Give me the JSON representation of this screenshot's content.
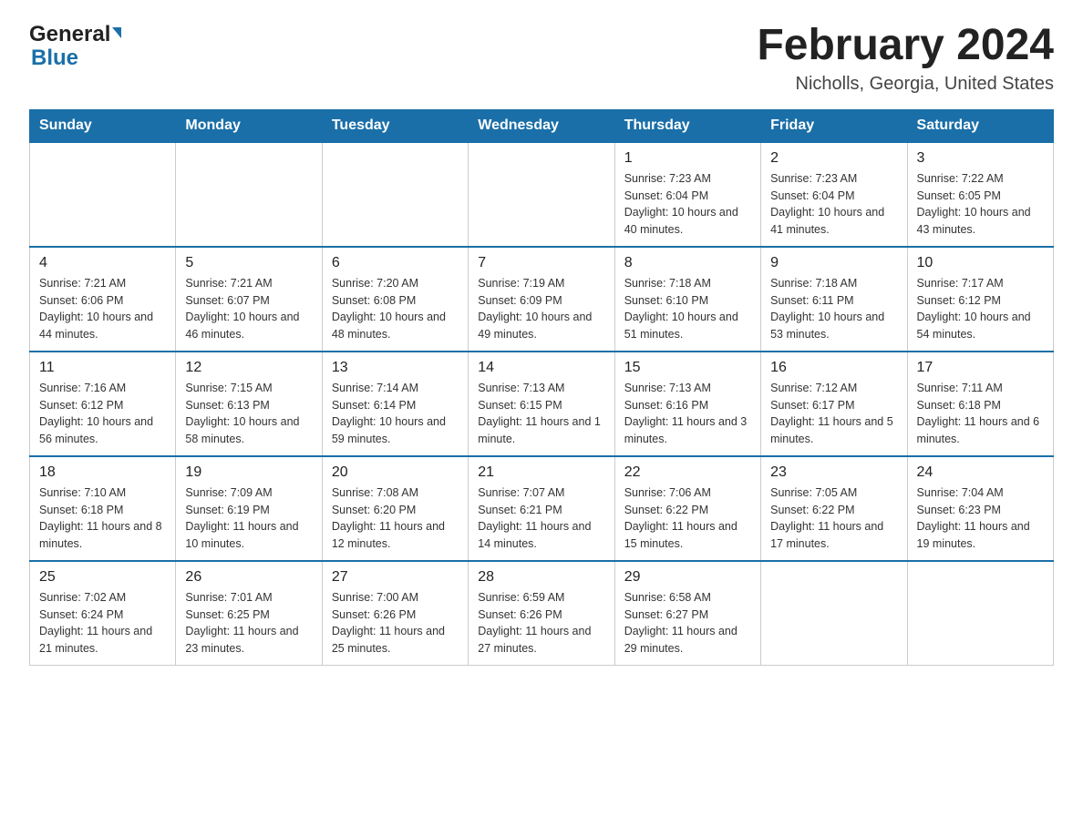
{
  "header": {
    "logo_general": "General",
    "logo_blue": "Blue",
    "title": "February 2024",
    "subtitle": "Nicholls, Georgia, United States"
  },
  "weekdays": [
    "Sunday",
    "Monday",
    "Tuesday",
    "Wednesday",
    "Thursday",
    "Friday",
    "Saturday"
  ],
  "weeks": [
    [
      {
        "day": "",
        "info": ""
      },
      {
        "day": "",
        "info": ""
      },
      {
        "day": "",
        "info": ""
      },
      {
        "day": "",
        "info": ""
      },
      {
        "day": "1",
        "info": "Sunrise: 7:23 AM\nSunset: 6:04 PM\nDaylight: 10 hours and 40 minutes."
      },
      {
        "day": "2",
        "info": "Sunrise: 7:23 AM\nSunset: 6:04 PM\nDaylight: 10 hours and 41 minutes."
      },
      {
        "day": "3",
        "info": "Sunrise: 7:22 AM\nSunset: 6:05 PM\nDaylight: 10 hours and 43 minutes."
      }
    ],
    [
      {
        "day": "4",
        "info": "Sunrise: 7:21 AM\nSunset: 6:06 PM\nDaylight: 10 hours and 44 minutes."
      },
      {
        "day": "5",
        "info": "Sunrise: 7:21 AM\nSunset: 6:07 PM\nDaylight: 10 hours and 46 minutes."
      },
      {
        "day": "6",
        "info": "Sunrise: 7:20 AM\nSunset: 6:08 PM\nDaylight: 10 hours and 48 minutes."
      },
      {
        "day": "7",
        "info": "Sunrise: 7:19 AM\nSunset: 6:09 PM\nDaylight: 10 hours and 49 minutes."
      },
      {
        "day": "8",
        "info": "Sunrise: 7:18 AM\nSunset: 6:10 PM\nDaylight: 10 hours and 51 minutes."
      },
      {
        "day": "9",
        "info": "Sunrise: 7:18 AM\nSunset: 6:11 PM\nDaylight: 10 hours and 53 minutes."
      },
      {
        "day": "10",
        "info": "Sunrise: 7:17 AM\nSunset: 6:12 PM\nDaylight: 10 hours and 54 minutes."
      }
    ],
    [
      {
        "day": "11",
        "info": "Sunrise: 7:16 AM\nSunset: 6:12 PM\nDaylight: 10 hours and 56 minutes."
      },
      {
        "day": "12",
        "info": "Sunrise: 7:15 AM\nSunset: 6:13 PM\nDaylight: 10 hours and 58 minutes."
      },
      {
        "day": "13",
        "info": "Sunrise: 7:14 AM\nSunset: 6:14 PM\nDaylight: 10 hours and 59 minutes."
      },
      {
        "day": "14",
        "info": "Sunrise: 7:13 AM\nSunset: 6:15 PM\nDaylight: 11 hours and 1 minute."
      },
      {
        "day": "15",
        "info": "Sunrise: 7:13 AM\nSunset: 6:16 PM\nDaylight: 11 hours and 3 minutes."
      },
      {
        "day": "16",
        "info": "Sunrise: 7:12 AM\nSunset: 6:17 PM\nDaylight: 11 hours and 5 minutes."
      },
      {
        "day": "17",
        "info": "Sunrise: 7:11 AM\nSunset: 6:18 PM\nDaylight: 11 hours and 6 minutes."
      }
    ],
    [
      {
        "day": "18",
        "info": "Sunrise: 7:10 AM\nSunset: 6:18 PM\nDaylight: 11 hours and 8 minutes."
      },
      {
        "day": "19",
        "info": "Sunrise: 7:09 AM\nSunset: 6:19 PM\nDaylight: 11 hours and 10 minutes."
      },
      {
        "day": "20",
        "info": "Sunrise: 7:08 AM\nSunset: 6:20 PM\nDaylight: 11 hours and 12 minutes."
      },
      {
        "day": "21",
        "info": "Sunrise: 7:07 AM\nSunset: 6:21 PM\nDaylight: 11 hours and 14 minutes."
      },
      {
        "day": "22",
        "info": "Sunrise: 7:06 AM\nSunset: 6:22 PM\nDaylight: 11 hours and 15 minutes."
      },
      {
        "day": "23",
        "info": "Sunrise: 7:05 AM\nSunset: 6:22 PM\nDaylight: 11 hours and 17 minutes."
      },
      {
        "day": "24",
        "info": "Sunrise: 7:04 AM\nSunset: 6:23 PM\nDaylight: 11 hours and 19 minutes."
      }
    ],
    [
      {
        "day": "25",
        "info": "Sunrise: 7:02 AM\nSunset: 6:24 PM\nDaylight: 11 hours and 21 minutes."
      },
      {
        "day": "26",
        "info": "Sunrise: 7:01 AM\nSunset: 6:25 PM\nDaylight: 11 hours and 23 minutes."
      },
      {
        "day": "27",
        "info": "Sunrise: 7:00 AM\nSunset: 6:26 PM\nDaylight: 11 hours and 25 minutes."
      },
      {
        "day": "28",
        "info": "Sunrise: 6:59 AM\nSunset: 6:26 PM\nDaylight: 11 hours and 27 minutes."
      },
      {
        "day": "29",
        "info": "Sunrise: 6:58 AM\nSunset: 6:27 PM\nDaylight: 11 hours and 29 minutes."
      },
      {
        "day": "",
        "info": ""
      },
      {
        "day": "",
        "info": ""
      }
    ]
  ]
}
